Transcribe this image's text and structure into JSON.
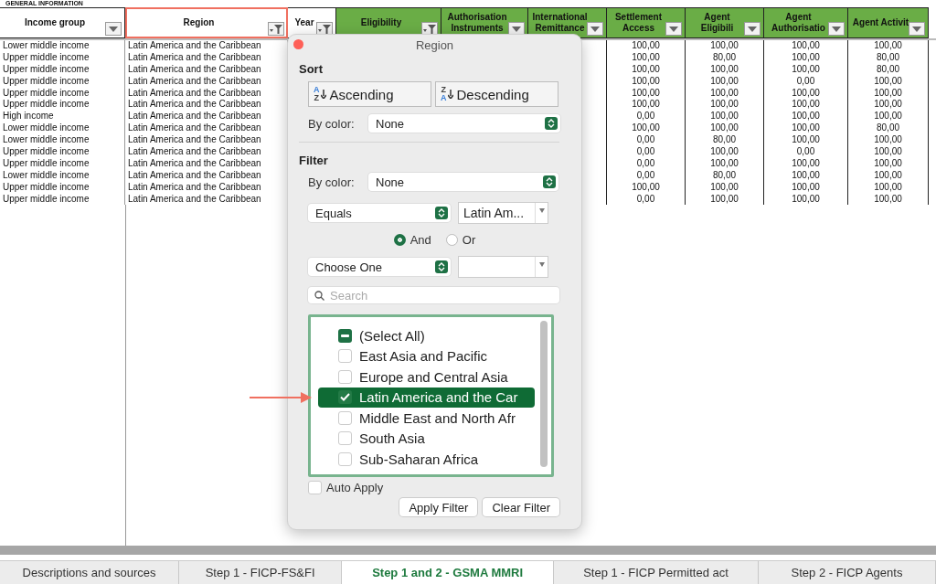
{
  "sheet": {
    "section_title": "GENERAL INFORMATION",
    "columns": [
      {
        "label": "Income group",
        "shaded": false,
        "filtered": false,
        "highlighted": false
      },
      {
        "label": "Region",
        "shaded": false,
        "filtered": true,
        "highlighted": true
      },
      {
        "label": "Year",
        "shaded": false,
        "filtered": true,
        "highlighted": false
      },
      {
        "label": "Eligibility",
        "shaded": true,
        "filtered": true,
        "highlighted": false
      },
      {
        "label": "Authorisation Instruments",
        "shaded": true,
        "filtered": false,
        "highlighted": false
      },
      {
        "label": "International Remittance",
        "shaded": true,
        "filtered": false,
        "highlighted": false
      },
      {
        "label": "Settlement Access",
        "shaded": true,
        "filtered": false,
        "highlighted": false
      },
      {
        "label": "Agent Eligibili",
        "shaded": true,
        "filtered": false,
        "highlighted": false
      },
      {
        "label": "Agent Authorisatio",
        "shaded": true,
        "filtered": false,
        "highlighted": false
      },
      {
        "label": "Agent Activit",
        "shaded": true,
        "filtered": false,
        "highlighted": false
      }
    ],
    "rows": [
      {
        "income_group": "Lower middle income",
        "region": "Latin America and the Caribbean",
        "values": [
          "100,00",
          "100,00",
          "100,00",
          "100,00"
        ]
      },
      {
        "income_group": "Upper middle income",
        "region": "Latin America and the Caribbean",
        "values": [
          "100,00",
          "80,00",
          "100,00",
          "80,00"
        ]
      },
      {
        "income_group": "Upper middle income",
        "region": "Latin America and the Caribbean",
        "values": [
          "100,00",
          "100,00",
          "100,00",
          "80,00"
        ]
      },
      {
        "income_group": "Upper middle income",
        "region": "Latin America and the Caribbean",
        "values": [
          "100,00",
          "100,00",
          "0,00",
          "100,00"
        ]
      },
      {
        "income_group": "Upper middle income",
        "region": "Latin America and the Caribbean",
        "values": [
          "100,00",
          "100,00",
          "100,00",
          "100,00"
        ]
      },
      {
        "income_group": "Upper middle income",
        "region": "Latin America and the Caribbean",
        "values": [
          "100,00",
          "100,00",
          "100,00",
          "100,00"
        ]
      },
      {
        "income_group": "High income",
        "region": "Latin America and the Caribbean",
        "values": [
          "0,00",
          "100,00",
          "100,00",
          "100,00"
        ]
      },
      {
        "income_group": "Lower middle income",
        "region": "Latin America and the Caribbean",
        "values": [
          "100,00",
          "100,00",
          "100,00",
          "80,00"
        ]
      },
      {
        "income_group": "Lower middle income",
        "region": "Latin America and the Caribbean",
        "values": [
          "0,00",
          "80,00",
          "100,00",
          "100,00"
        ]
      },
      {
        "income_group": "Upper middle income",
        "region": "Latin America and the Caribbean",
        "values": [
          "0,00",
          "100,00",
          "0,00",
          "100,00"
        ]
      },
      {
        "income_group": "Upper middle income",
        "region": "Latin America and the Caribbean",
        "values": [
          "0,00",
          "100,00",
          "100,00",
          "100,00"
        ]
      },
      {
        "income_group": "Lower middle income",
        "region": "Latin America and the Caribbean",
        "values": [
          "0,00",
          "80,00",
          "100,00",
          "100,00"
        ]
      },
      {
        "income_group": "Upper middle income",
        "region": "Latin America and the Caribbean",
        "values": [
          "100,00",
          "100,00",
          "100,00",
          "100,00"
        ]
      },
      {
        "income_group": "Upper middle income",
        "region": "Latin America and the Caribbean",
        "values": [
          "0,00",
          "100,00",
          "100,00",
          "100,00"
        ]
      }
    ]
  },
  "filter_dialog": {
    "title": "Region",
    "sort": {
      "heading": "Sort",
      "buttons": [
        {
          "label": "Ascending",
          "icon_top": "A",
          "icon_bottom": "Z"
        },
        {
          "label": "Descending",
          "icon_top": "Z",
          "icon_bottom": "A"
        }
      ],
      "by_color_label": "By color:",
      "by_color_value": "None"
    },
    "filter": {
      "heading": "Filter",
      "by_color_label": "By color:",
      "by_color_value": "None",
      "condition_1": {
        "operator": "Equals",
        "value": "Latin Am..."
      },
      "joins": [
        {
          "label": "And",
          "selected": true
        },
        {
          "label": "Or",
          "selected": false
        }
      ],
      "condition_2": {
        "operator": "Choose One"
      },
      "search": {
        "placeholder": "Search"
      },
      "items": [
        {
          "label": "(Select All)",
          "mixed": true,
          "selected": false
        },
        {
          "label": "East Asia and Pacific",
          "checked": false,
          "selected": false
        },
        {
          "label": "Europe and Central Asia",
          "checked": false,
          "selected": false
        },
        {
          "label": "Latin America and the Car",
          "checked": true,
          "selected": true,
          "pointed": true
        },
        {
          "label": "Middle East and North Afr",
          "checked": false,
          "selected": false
        },
        {
          "label": "South Asia",
          "checked": false,
          "selected": false
        },
        {
          "label": "Sub-Saharan Africa",
          "checked": false,
          "selected": false
        }
      ],
      "auto_apply": {
        "label": "Auto Apply",
        "checked": false
      },
      "buttons": [
        "Apply Filter",
        "Clear Filter"
      ]
    }
  },
  "sheet_tabs": [
    {
      "label": "Descriptions and sources",
      "selected": false
    },
    {
      "label": "Step 1 - FICP-FS&FI",
      "selected": false
    },
    {
      "label": "Step 1 and 2 - GSMA MMRI",
      "selected": true
    },
    {
      "label": "Step 1 - FICP Permitted act",
      "selected": false
    },
    {
      "label": "Step 2 - FICP Agents",
      "selected": false
    }
  ]
}
